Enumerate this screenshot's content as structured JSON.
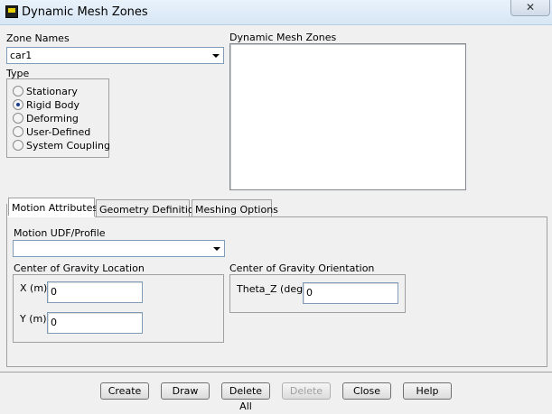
{
  "window": {
    "title": "Dynamic Mesh Zones",
    "close_glyph": "✕"
  },
  "zone_names": {
    "label": "Zone Names",
    "selected": "car1"
  },
  "type": {
    "label": "Type",
    "options": [
      {
        "label": "Stationary",
        "checked": false
      },
      {
        "label": "Rigid Body",
        "checked": true
      },
      {
        "label": "Deforming",
        "checked": false
      },
      {
        "label": "User-Defined",
        "checked": false
      },
      {
        "label": "System Coupling",
        "checked": false
      }
    ]
  },
  "dynamic_mesh_zones": {
    "label": "Dynamic Mesh Zones",
    "items": []
  },
  "tabs": [
    {
      "label": "Motion Attributes",
      "active": true
    },
    {
      "label": "Geometry Definition",
      "active": false
    },
    {
      "label": "Meshing Options",
      "active": false
    }
  ],
  "motion": {
    "udf_label": "Motion UDF/Profile",
    "udf_selected": "",
    "cog_location": {
      "label": "Center of Gravity Location",
      "x_label": "X (m)",
      "x_value": "0",
      "y_label": "Y (m)",
      "y_value": "0"
    },
    "cog_orientation": {
      "label": "Center of Gravity Orientation",
      "theta_label": "Theta_Z (deg)",
      "theta_value": "0"
    }
  },
  "buttons": {
    "create": "Create",
    "draw": "Draw",
    "delete_all": "Delete All",
    "delete": "Delete",
    "close": "Close",
    "help": "Help"
  }
}
